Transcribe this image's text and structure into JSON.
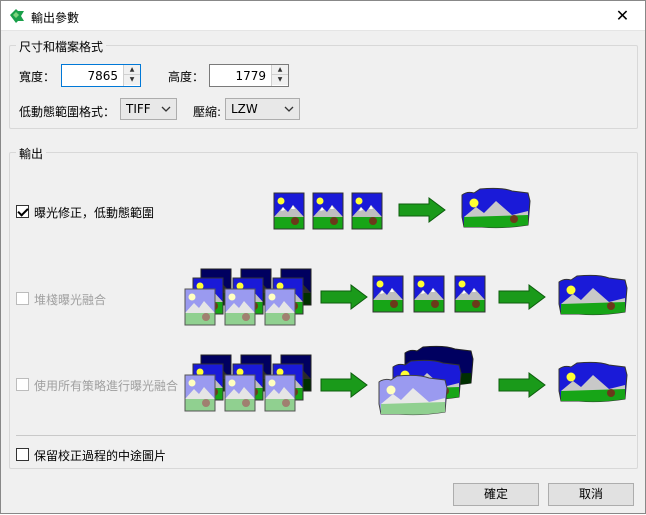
{
  "window": {
    "title": "輸出參數",
    "close_glyph": "✕"
  },
  "size_format_group": {
    "legend": "尺寸和檔案格式",
    "width_label": "寬度：",
    "width_value": "7865",
    "height_label": "高度：",
    "height_value": "1779",
    "hdr_format_label": "低動態範圍格式：",
    "hdr_format_value": "TIFF",
    "compression_label": "壓縮:",
    "compression_value": "LZW"
  },
  "output_group": {
    "legend": "輸出",
    "option1": {
      "label": "曝光修正，低動態範圍",
      "checked": true,
      "enabled": true
    },
    "option2": {
      "label": "堆棧曝光融合",
      "checked": false,
      "enabled": false
    },
    "option3": {
      "label": "使用所有策略進行曝光融合",
      "checked": false,
      "enabled": false
    },
    "keep_intermediate": {
      "label": "保留校正過程的中途圖片",
      "checked": false
    }
  },
  "buttons": {
    "ok": "確定",
    "cancel": "取消"
  },
  "colors": {
    "sky": "#1010d0",
    "grass": "#14a014",
    "arrow": "#1a9a1a",
    "sun": "#ffff33"
  }
}
